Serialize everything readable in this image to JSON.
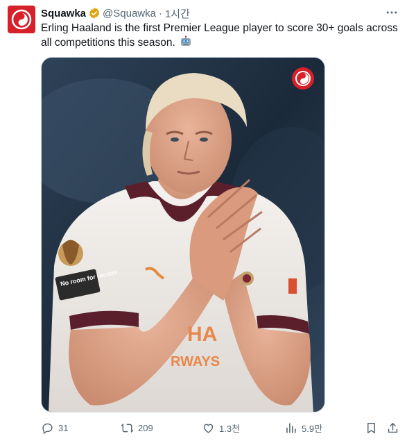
{
  "tweet": {
    "author_name": "Squawka",
    "handle": "@Squawka",
    "separator": "·",
    "time": "1시간",
    "text": "Erling Haaland is the first Premier League player to score 30+ goals across all competitions this season.",
    "emoji": "robot-face"
  },
  "media": {
    "description_icon": "squawka-logo",
    "jersey_patch_text": "No room for racism",
    "sponsor_fragment_top": "HA",
    "sponsor_fragment_bottom": "RWAYS"
  },
  "metrics": {
    "replies": "31",
    "reposts": "209",
    "likes": "1.3천",
    "views": "5.9만"
  },
  "colors": {
    "brand": "#d6202a",
    "verified": "#f4b400",
    "secondary_text": "#536471"
  }
}
